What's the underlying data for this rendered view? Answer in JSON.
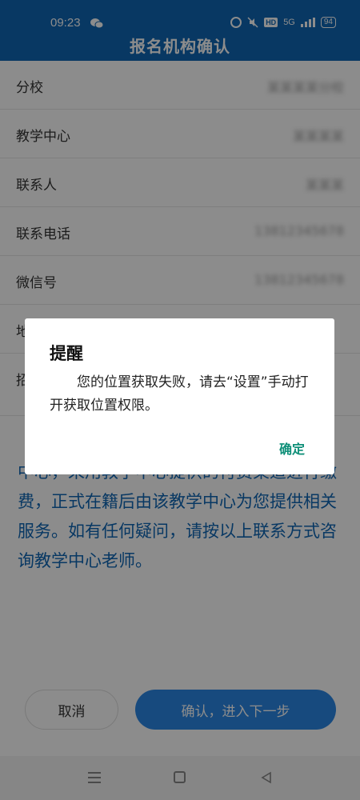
{
  "status_bar": {
    "time": "09:23",
    "battery": "94",
    "signal_label": "5G",
    "hd_label": "HD",
    "icons": [
      "wechat-icon",
      "alarm-icon",
      "mute-icon",
      "hd-icon",
      "signal-icon",
      "battery-icon"
    ]
  },
  "header": {
    "title": "报名机构确认"
  },
  "form": {
    "rows": [
      {
        "label": "分校",
        "value": "某某某某分校"
      },
      {
        "label": "教学中心",
        "value": "某某某某"
      },
      {
        "label": "联系人",
        "value": "某某某"
      },
      {
        "label": "联系电话",
        "value": "13812345678"
      },
      {
        "label": "微信号",
        "value": "13812345678"
      },
      {
        "label": "地",
        "value": ""
      },
      {
        "label": "招",
        "value": ""
      }
    ]
  },
  "notice": {
    "text": "中心，采用教学中心提供的付费渠道进行缴费，正式在籍后由该教学中心为您提供相关服务。如有任何疑问，请按以上联系方式咨询教学中心老师。"
  },
  "buttons": {
    "cancel": "取消",
    "next": "确认，进入下一步"
  },
  "dialog": {
    "title": "提醒",
    "message": "您的位置获取失败，请去“设置”手动打开获取位置权限。",
    "ok": "确定"
  },
  "colors": {
    "primary": "#0f66b5",
    "button": "#2a88e6",
    "dialog_action": "#0e8f78"
  }
}
